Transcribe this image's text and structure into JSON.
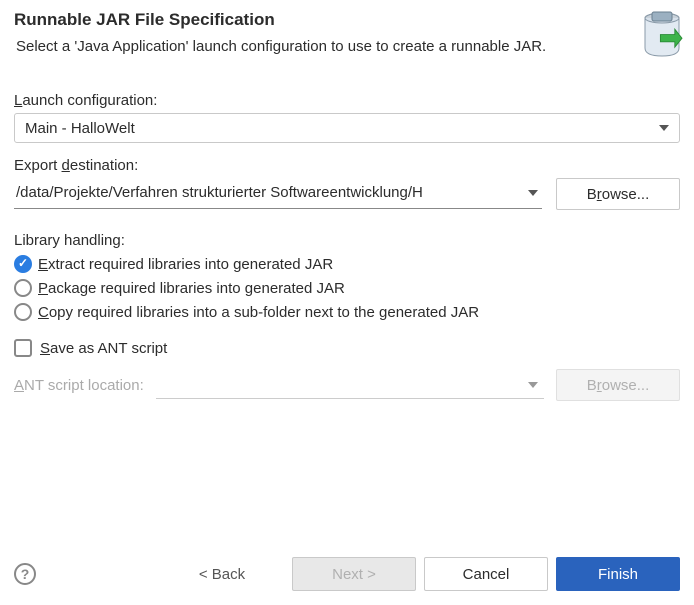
{
  "header": {
    "title": "Runnable JAR File Specification",
    "subtitle": "Select a 'Java Application' launch configuration to use to create a runnable JAR."
  },
  "launch": {
    "label_pre": "L",
    "label_post": "aunch configuration:",
    "value": "Main - HalloWelt"
  },
  "export": {
    "label_pre": "Export ",
    "label_u": "d",
    "label_post": "estination:",
    "value": "/data/Projekte/Verfahren strukturierter Softwareentwicklung/H",
    "browse_pre": "B",
    "browse_u": "r",
    "browse_post": "owse..."
  },
  "library": {
    "label": "Library handling:",
    "options": [
      {
        "pre": "",
        "u": "E",
        "post": "xtract required libraries into generated JAR",
        "checked": true
      },
      {
        "pre": "",
        "u": "P",
        "post": "ackage required libraries into generated JAR",
        "checked": false
      },
      {
        "pre": "",
        "u": "C",
        "post": "opy required libraries into a sub-folder next to the generated JAR",
        "checked": false
      }
    ]
  },
  "ant": {
    "save_pre": "",
    "save_u": "S",
    "save_post": "ave as ANT script",
    "loc_pre": "",
    "loc_u": "A",
    "loc_post": "NT script location:",
    "browse_pre": "B",
    "browse_u": "r",
    "browse_post": "owse..."
  },
  "footer": {
    "back": "< Back",
    "next": "Next >",
    "cancel": "Cancel",
    "finish": "Finish"
  }
}
